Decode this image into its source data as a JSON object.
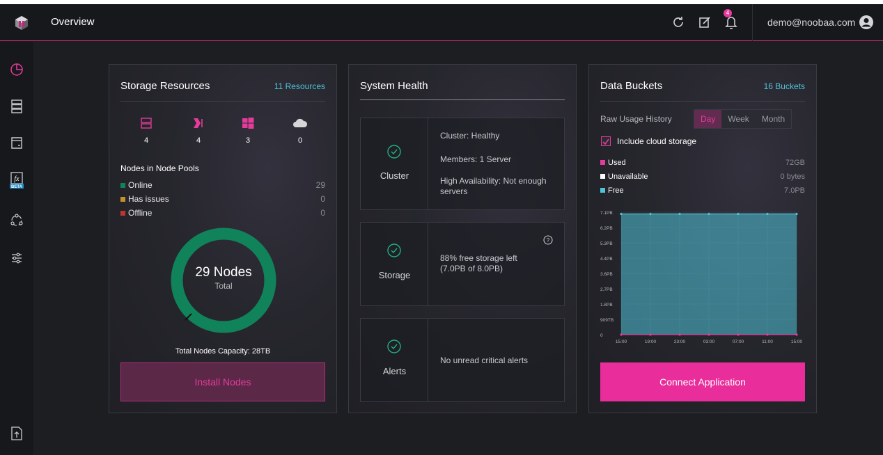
{
  "header": {
    "title": "Overview",
    "user_email": "demo@noobaa.com",
    "notification_count": "4",
    "icons": [
      "refresh-icon",
      "edit-icon",
      "bell-icon",
      "user-avatar-icon"
    ]
  },
  "sidebar": {
    "items": [
      {
        "name": "overview",
        "icon": "pie-chart-icon",
        "active": true
      },
      {
        "name": "resources",
        "icon": "servers-icon"
      },
      {
        "name": "buckets",
        "icon": "bucket-icon"
      },
      {
        "name": "functions",
        "icon": "fx-icon",
        "badge": "BETA"
      },
      {
        "name": "cluster",
        "icon": "cluster-icon"
      },
      {
        "name": "management",
        "icon": "sliders-icon"
      }
    ],
    "bottom_icon": "upload-file-icon"
  },
  "storage_resources": {
    "title": "Storage Resources",
    "link": "11 Resources",
    "resources": [
      {
        "icon": "server-icon",
        "count": "4"
      },
      {
        "icon": "storage-node-icon",
        "count": "4"
      },
      {
        "icon": "windows-icon",
        "count": "3"
      },
      {
        "icon": "cloud-icon",
        "count": "0"
      }
    ],
    "node_pools_heading": "Nodes in Node Pools",
    "legend": [
      {
        "label": "Online",
        "value": "29",
        "color": "#11835b"
      },
      {
        "label": "Has issues",
        "value": "0",
        "color": "#c4922b"
      },
      {
        "label": "Offline",
        "value": "0",
        "color": "#c2322f"
      }
    ],
    "donut": {
      "number": "29 Nodes",
      "sub": "Total",
      "online_fraction": 1.0
    },
    "capacity": "Total Nodes Capacity: 28TB",
    "install_label": "Install Nodes"
  },
  "system_health": {
    "title": "System Health",
    "cards": [
      {
        "label": "Cluster",
        "lines": [
          "Cluster: Healthy",
          "Members: 1 Server",
          "High Availability: Not enough servers"
        ]
      },
      {
        "label": "Storage",
        "lines": [
          "88% free storage left (7.0PB of 8.0PB)"
        ]
      },
      {
        "label": "Alerts",
        "lines": [
          "No unread critical alerts"
        ]
      }
    ]
  },
  "data_buckets": {
    "title": "Data Buckets",
    "link": "16 Buckets",
    "usage_label": "Raw Usage History",
    "tabs": [
      "Day",
      "Week",
      "Month"
    ],
    "active_tab": "Day",
    "cloud_storage_label": "Include cloud storage",
    "cloud_storage_checked": true,
    "legend": [
      {
        "label": "Used",
        "value": "72GB",
        "color": "#e53b9b"
      },
      {
        "label": "Unavailable",
        "value": "0 bytes",
        "color": "#ffffff"
      },
      {
        "label": "Free",
        "value": "7.0PB",
        "color": "#4fc3d8"
      }
    ],
    "connect_label": "Connect Application"
  },
  "chart_data": {
    "type": "area",
    "x": [
      "15:00",
      "19:00",
      "23:00",
      "03:00",
      "07:00",
      "11:00",
      "15:00"
    ],
    "y_ticks": [
      "0",
      "909TB",
      "1.8PB",
      "2.7PB",
      "3.6PB",
      "4.4PB",
      "5.3PB",
      "6.2PB",
      "7.1PB"
    ],
    "series": [
      {
        "name": "Free",
        "values": [
          7.0,
          7.0,
          7.0,
          7.0,
          7.0,
          7.0,
          7.0
        ],
        "color": "#4fc3d8"
      },
      {
        "name": "Used",
        "values": [
          0,
          0,
          0,
          0,
          0,
          0,
          0
        ],
        "color": "#e53b9b"
      }
    ],
    "ylim": [
      0,
      7.1
    ],
    "grid": true
  }
}
